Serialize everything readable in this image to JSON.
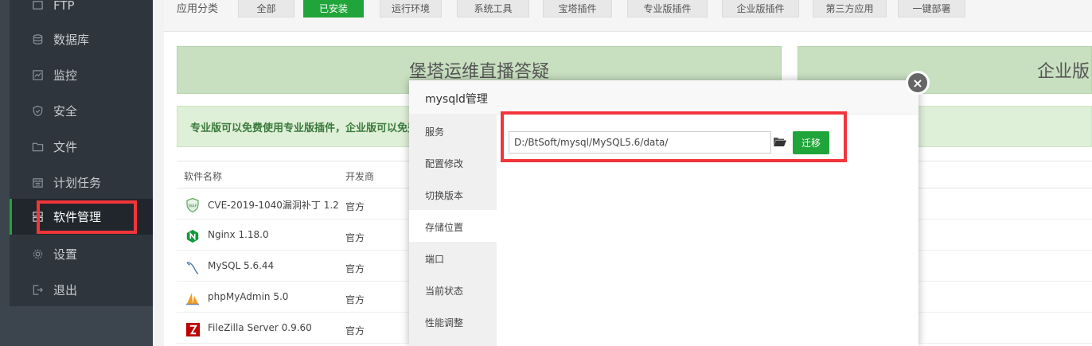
{
  "sidebar": {
    "items": [
      {
        "label": "FTP",
        "icon": "ftp-icon"
      },
      {
        "label": "数据库",
        "icon": "database-icon"
      },
      {
        "label": "监控",
        "icon": "monitor-icon"
      },
      {
        "label": "安全",
        "icon": "shield-icon"
      },
      {
        "label": "文件",
        "icon": "folder-icon"
      },
      {
        "label": "计划任务",
        "icon": "calendar-icon"
      },
      {
        "label": "软件管理",
        "icon": "apps-icon"
      },
      {
        "label": "设置",
        "icon": "gear-icon"
      },
      {
        "label": "退出",
        "icon": "logout-icon"
      }
    ]
  },
  "categories": {
    "label": "应用分类",
    "buttons": [
      "全部",
      "已安装",
      "运行环境",
      "系统工具",
      "宝塔插件",
      "专业版插件",
      "企业版插件",
      "第三方应用",
      "一键部署"
    ],
    "selected": "已安装"
  },
  "banners": {
    "left": "堡塔运维直播答疑",
    "right": "企业版"
  },
  "notice": "专业版可以免费使用专业版插件，企业版可以免费",
  "table": {
    "headers": [
      "软件名称",
      "开发商"
    ],
    "rows": [
      {
        "name": "CVE-2019-1040漏洞补丁 1.2",
        "dev": "官方",
        "icon": "waf-icon"
      },
      {
        "name": "Nginx 1.18.0",
        "dev": "官方",
        "icon": "nginx-icon"
      },
      {
        "name": "MySQL 5.6.44",
        "dev": "官方",
        "icon": "mysql-icon"
      },
      {
        "name": "phpMyAdmin 5.0",
        "dev": "官方",
        "icon": "phpmyadmin-icon"
      },
      {
        "name": "FileZilla Server 0.9.60",
        "dev": "官方",
        "icon": "filezilla-icon"
      }
    ]
  },
  "modal": {
    "title": "mysqld管理",
    "tabs": [
      "服务",
      "配置修改",
      "切换版本",
      "存储位置",
      "端口",
      "当前状态",
      "性能调整"
    ],
    "active_tab": "存储位置",
    "path_value": "D:/BtSoft/mysql/MySQL5.6/data/",
    "move_button": "迁移",
    "close": "×"
  },
  "colors": {
    "accent": "#20a53a",
    "highlight": "#f2353b",
    "sidebar_bg": "#2f353d"
  }
}
